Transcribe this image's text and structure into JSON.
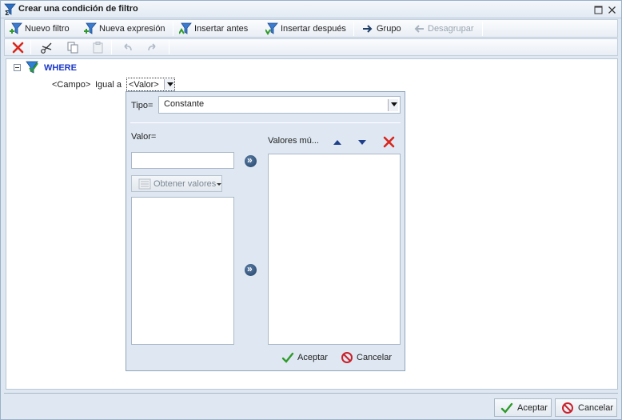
{
  "window": {
    "title": "Crear una condición de filtro",
    "title_icon": "sigma-filter-icon"
  },
  "toolbar": {
    "items": [
      {
        "label": "Nuevo filtro",
        "icon": "new-filter-icon",
        "enabled": true
      },
      {
        "label": "Nueva expresión",
        "icon": "new-expression-icon",
        "enabled": true
      },
      {
        "label": "Insertar antes",
        "icon": "insert-before-icon",
        "enabled": true
      },
      {
        "label": "Insertar después",
        "icon": "insert-after-icon",
        "enabled": true
      },
      {
        "label": "Grupo",
        "icon": "group-arrow-icon",
        "enabled": true
      },
      {
        "label": "Desagrupar",
        "icon": "ungroup-arrow-icon",
        "enabled": false
      }
    ]
  },
  "toolbar2": {
    "icons": [
      "delete-icon",
      "cut-icon",
      "copy-icon",
      "paste-icon",
      "undo-icon",
      "redo-icon"
    ]
  },
  "tree": {
    "root_label": "WHERE",
    "condition": {
      "field": "<Campo>",
      "operator": "Igual a",
      "value": "<Valor>"
    }
  },
  "popup": {
    "tipo_label": "Tipo=",
    "tipo_value": "Constante",
    "valor_label": "Valor=",
    "valor_value": "",
    "get_values_label": "Obtener valores",
    "multi_values_label": "Valores mú...",
    "ok_label": "Aceptar",
    "cancel_label": "Cancelar"
  },
  "footer": {
    "ok_label": "Aceptar",
    "cancel_label": "Cancelar"
  },
  "colors": {
    "accent_blue": "#1a37c8",
    "delete_red": "#d8261c",
    "ok_green": "#2f9a2a",
    "cancel_red": "#c8202a"
  }
}
